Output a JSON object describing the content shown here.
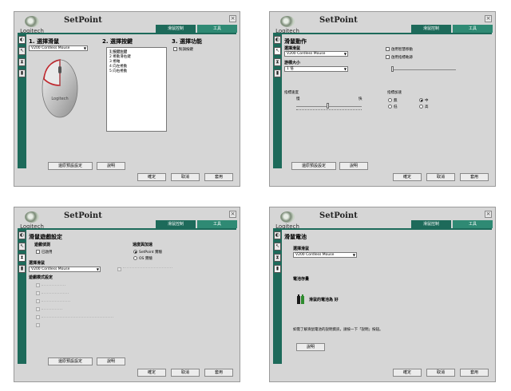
{
  "app": {
    "brand": "Logitech",
    "title": "SetPoint",
    "close": "×"
  },
  "tabs": {
    "mouse": "滑鼠控制",
    "tools": "工具"
  },
  "buttons": {
    "ok": "確定",
    "cancel": "取消",
    "apply": "套用",
    "defaults": "還原預設設定",
    "help": "說明"
  },
  "panel1": {
    "step1": "1. 選擇滑鼠",
    "step2": "2. 選擇按鍵",
    "step3": "3. 選擇功能",
    "mouse_select": "V200 Cordless Mouse",
    "mouse_brand": "Logitech",
    "buttons_list": [
      "1 按鍵左鍵",
      "2 捲動滑右鍵",
      "3 捲軸",
      "4 向左捲動",
      "5 向右捲動"
    ],
    "func_checkbox": "對調按鍵"
  },
  "panel2": {
    "heading": "滑鼠動作",
    "select_mouse_label": "選擇滑鼠",
    "mouse_select": "V200 Cordless Mouse",
    "pointer_size_label": "游標大小",
    "pointer_size_value": "1 倍",
    "check1": "啟用智慧移動",
    "check2": "啟用指標軌跡",
    "speed_label": "指標速度",
    "slow": "慢",
    "fast": "快",
    "accel_label": "指標加速",
    "accel_none": "無",
    "accel_low": "低",
    "accel_mid": "中",
    "accel_high": "高",
    "accel_selected": "中"
  },
  "panel3": {
    "heading": "滑鼠遊戲設定",
    "game_mode": "遊戲偵測",
    "game_check": "已啟用",
    "select_mouse_label": "選擇滑鼠",
    "mouse_select": "V200 Cordless Mouse",
    "speed_accel": "速度與加速",
    "radio_setpoint": "SetPoint 實驗",
    "radio_os": "OS 實驗",
    "radio_selected": "SetPoint 實驗",
    "mode_settings": "遊戲模式設定"
  },
  "panel4": {
    "heading": "滑鼠電池",
    "select_mouse_label": "選擇滑鼠",
    "mouse_select": "V200 Cordless Mouse",
    "battery_heading": "電池存量",
    "battery_status": "滑鼠的電池為 好",
    "info": "如需了解滑鼠電池的說明資訊，請按一下「說明」按鈕。"
  }
}
